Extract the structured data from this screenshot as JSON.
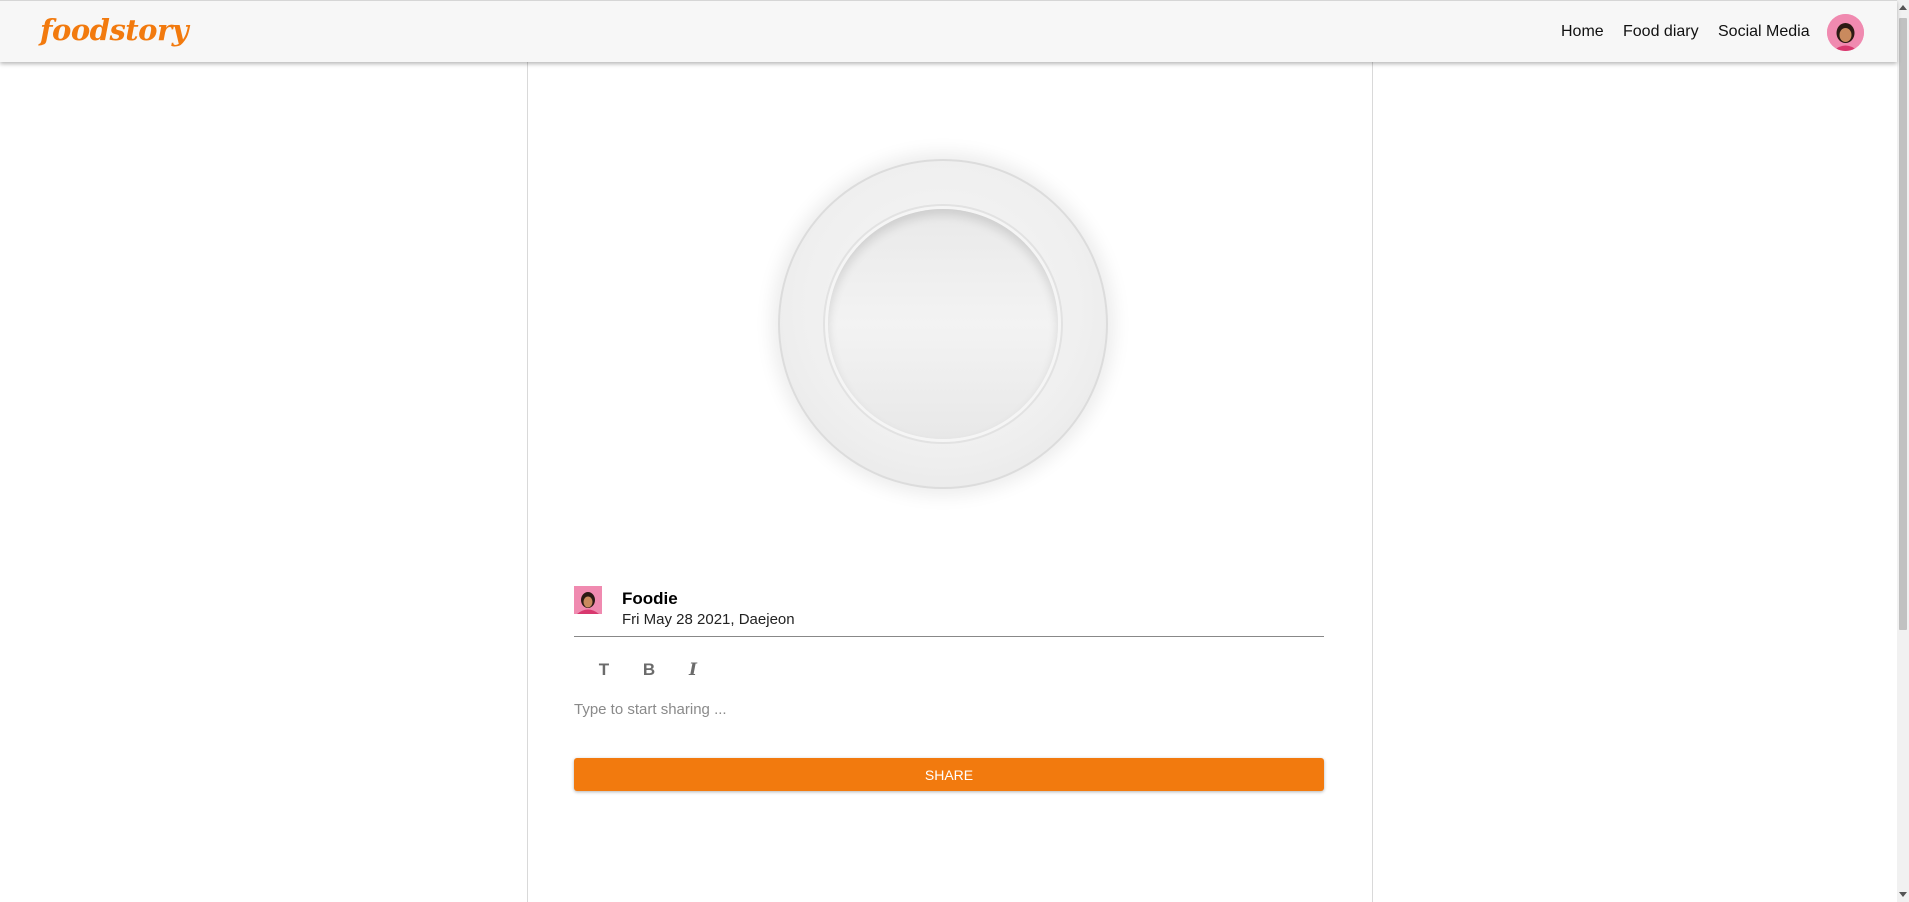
{
  "header": {
    "logo": "foodstory",
    "nav": {
      "home": "Home",
      "food_diary": "Food diary",
      "social_media": "Social Media"
    },
    "avatar_icon": "user-avatar-icon"
  },
  "post": {
    "author": "Foodie",
    "meta": "Fri May 28 2021, Daejeon",
    "toolbar": {
      "text_label": "T",
      "bold_label": "B",
      "italic_label": "I"
    },
    "editor_placeholder": "Type to start sharing ...",
    "share_label": "SHARE"
  },
  "colors": {
    "accent": "#f27a0e",
    "avatar_bg": "#f08ab0"
  }
}
